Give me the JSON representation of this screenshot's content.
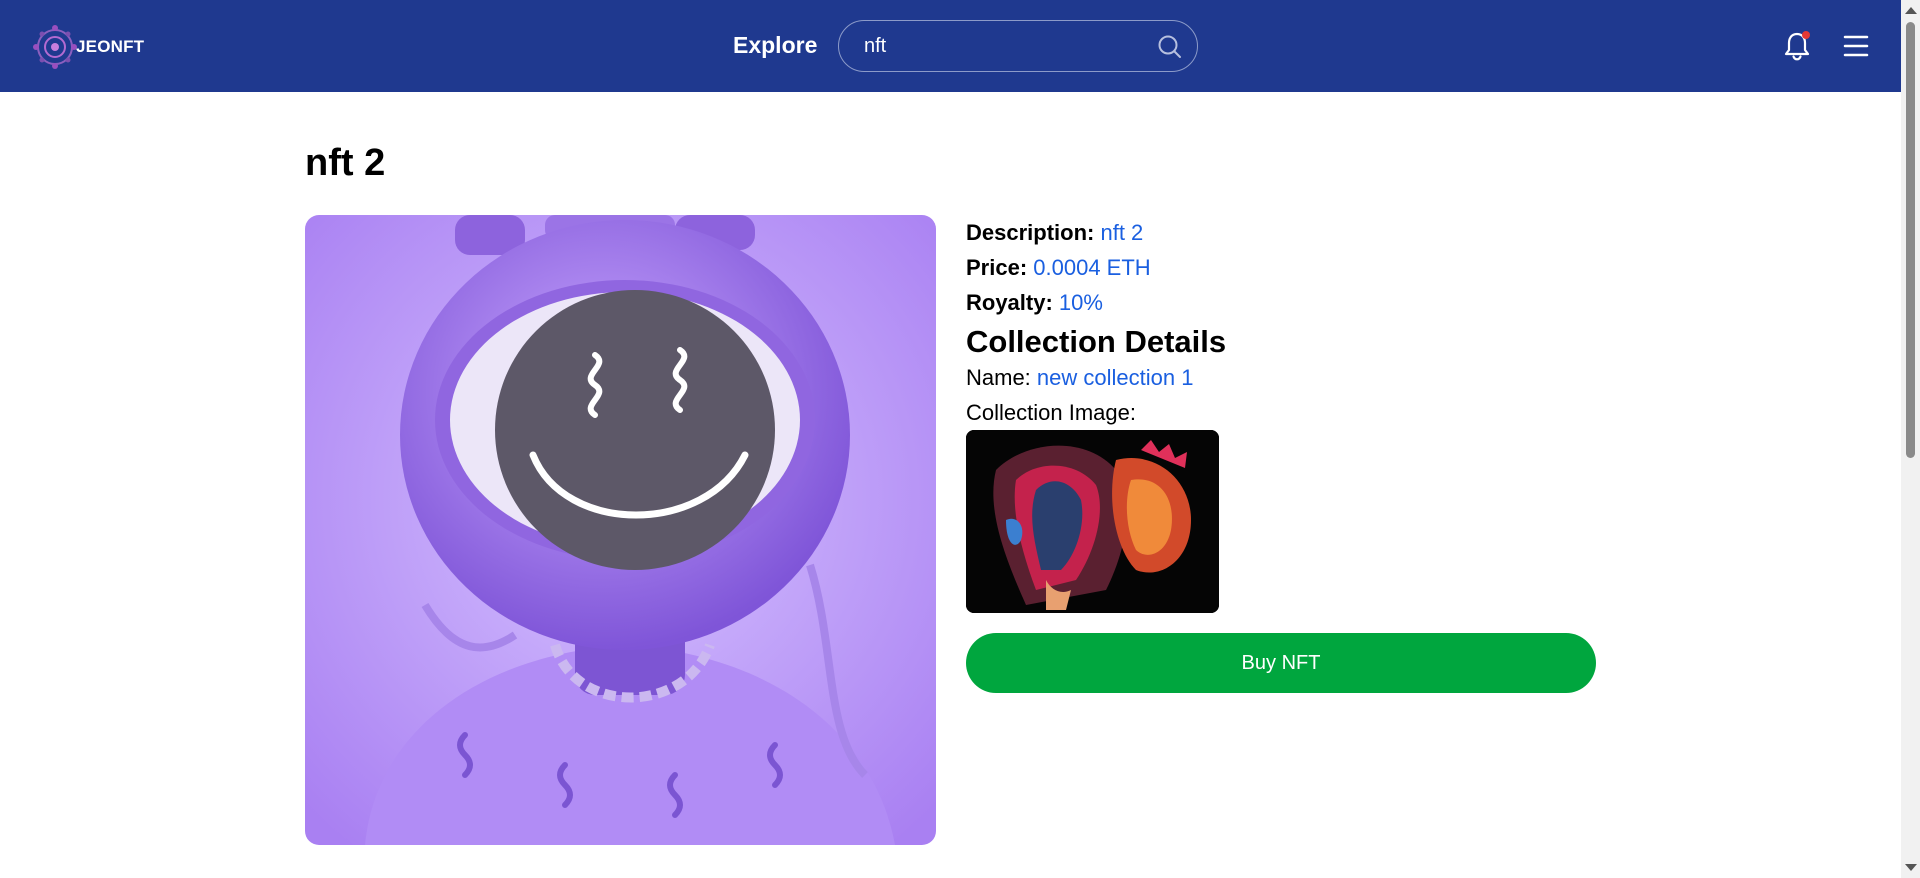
{
  "header": {
    "logo_text": "JEONFT",
    "explore_label": "Explore",
    "search_value": "nft",
    "icons": [
      "logo-icon",
      "search-icon",
      "bell-icon",
      "menu-icon"
    ]
  },
  "nft": {
    "title": "nft 2",
    "description_label": "Description:",
    "description_value": "nft 2",
    "price_label": "Price:",
    "price_value": "0.0004 ETH",
    "royalty_label": "Royalty:",
    "royalty_value": "10%"
  },
  "collection": {
    "heading": "Collection Details",
    "name_label": "Name:",
    "name_value": "new collection 1",
    "image_label": "Collection Image:"
  },
  "actions": {
    "buy_label": "Buy NFT"
  },
  "colors": {
    "header_bg": "#1f398f",
    "link_blue": "#1a5fe0",
    "buy_green": "#00a63e",
    "notification_dot": "#e53935"
  }
}
